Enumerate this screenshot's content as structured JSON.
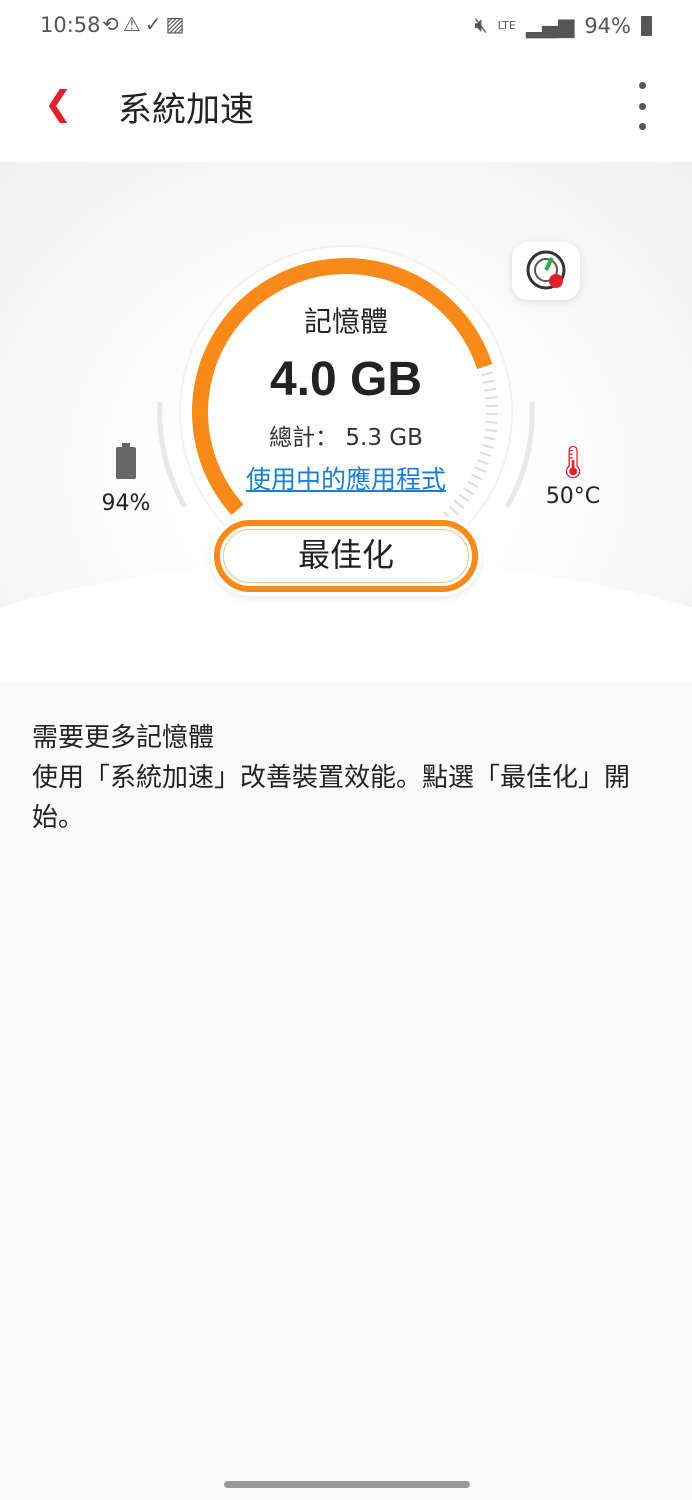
{
  "status_bar": {
    "time": "10:58",
    "battery": "94%",
    "icons": [
      "sync-icon",
      "sync-alert-icon",
      "download-done-icon",
      "image-icon",
      "mute-icon",
      "lte-icon",
      "signal-icon",
      "battery-icon"
    ]
  },
  "app_bar": {
    "title": "系統加速"
  },
  "gauge": {
    "label": "記憶體",
    "used": "4.0 GB",
    "total": "總計： 5.3 GB",
    "used_fraction": 0.755,
    "accent": "#f78a18",
    "link": "使用中的應用程式"
  },
  "battery": {
    "value": "94%"
  },
  "temperature": {
    "value": "50°C"
  },
  "optimize_button": "最佳化",
  "description": {
    "heading": "需要更多記憶體",
    "body": "使用「系統加速」改善裝置效能。點選「最佳化」開始。"
  }
}
